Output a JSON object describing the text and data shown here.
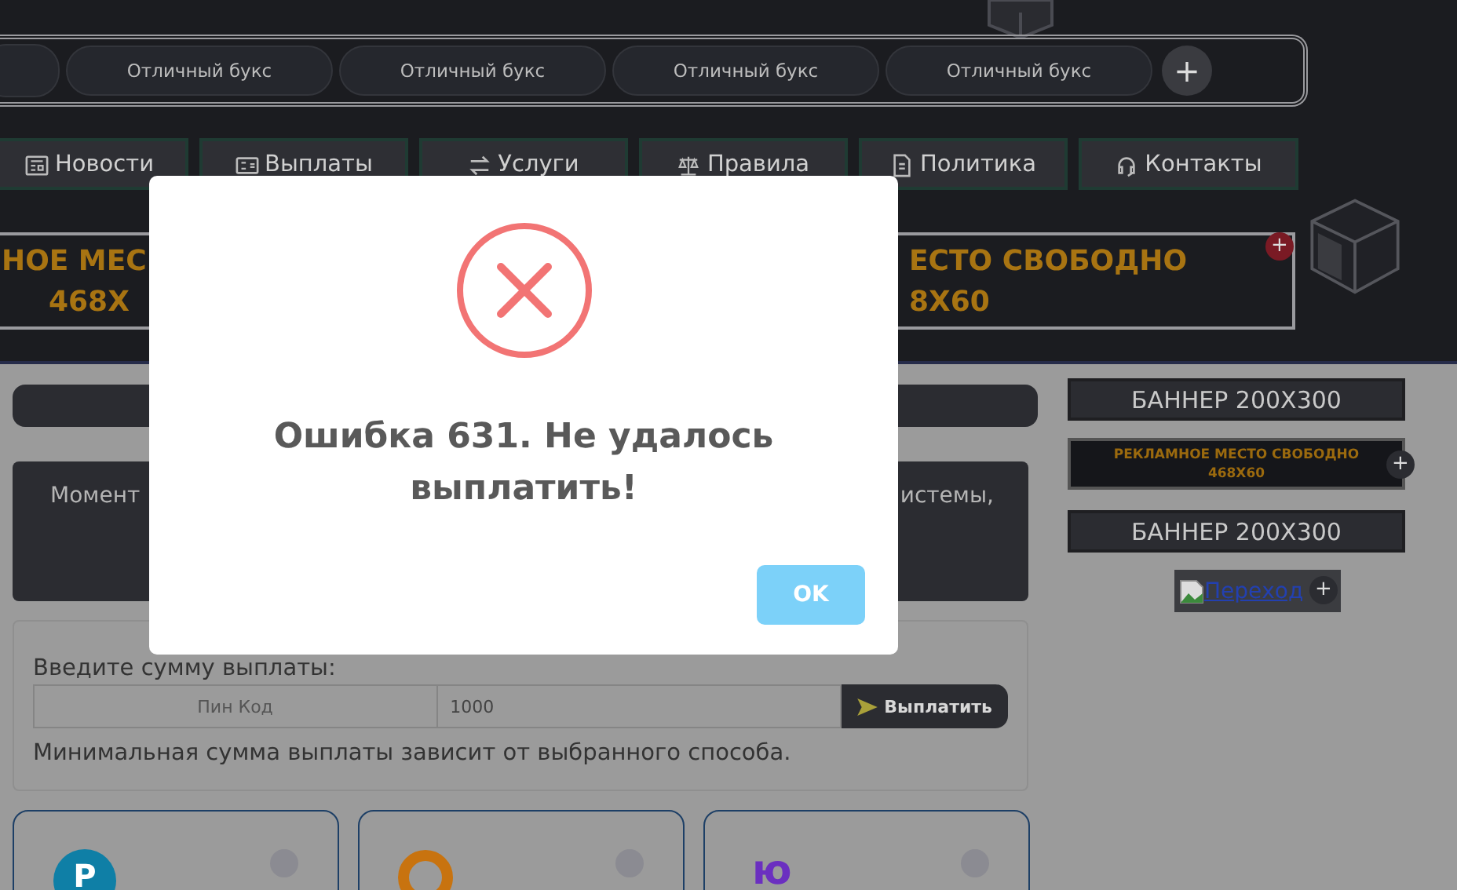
{
  "tabs": [
    {
      "label": "Отличный букс"
    },
    {
      "label": "Отличный букс"
    },
    {
      "label": "Отличный букс"
    },
    {
      "label": "Отличный букс"
    }
  ],
  "add_button": "+",
  "nav": [
    {
      "label": "Новости"
    },
    {
      "label": "Выплаты"
    },
    {
      "label": "Услуги"
    },
    {
      "label": "Правила"
    },
    {
      "label": "Политика"
    },
    {
      "label": "Контакты"
    }
  ],
  "banners": [
    {
      "lines": [
        "НОЕ МЕС",
        "468X"
      ]
    },
    {
      "lines": [
        "ЕСТО СВОБОДНО",
        "8X60"
      ],
      "badge": "+"
    }
  ],
  "info_panel": {
    "left_text": "Момент",
    "right_text": "истемы,"
  },
  "payout_form": {
    "label": "Введите сумму выплаты:",
    "pin_placeholder": "Пин Код",
    "amount": "1000",
    "submit": "Выплатить",
    "note": "Минимальная сумма выплаты зависит от выбранного способа."
  },
  "methods": [
    {
      "kind": "letter",
      "logo": "P",
      "color": "#0f7fa6",
      "selected": false
    },
    {
      "kind": "ring",
      "color": "#c8730f",
      "selected": false
    },
    {
      "kind": "letter",
      "logo": "ю",
      "color": "#6b2fc0",
      "selected": false
    }
  ],
  "sidebar": [
    {
      "kind": "banner",
      "text": "БАННЕР 200X300"
    },
    {
      "kind": "ad",
      "lines": [
        "РЕКЛАМНОЕ МЕСТО СВОБОДНО",
        "468X60"
      ],
      "badge": "+"
    },
    {
      "kind": "banner",
      "text": "БАННЕР 200X300"
    },
    {
      "kind": "image_link",
      "text": "Переход",
      "badge": "+"
    }
  ],
  "dialog": {
    "title": "Ошибка 631. Не удалось выплатить!",
    "button": "OK"
  }
}
